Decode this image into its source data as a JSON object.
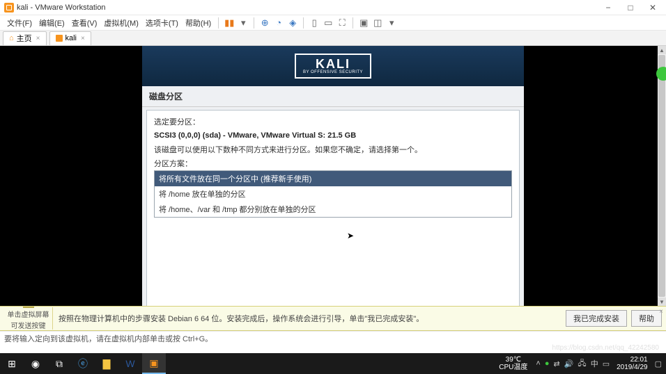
{
  "window": {
    "title": "kali - VMware Workstation"
  },
  "menubar": {
    "items": [
      "文件(F)",
      "编辑(E)",
      "查看(V)",
      "虚拟机(M)",
      "选项卡(T)",
      "帮助(H)"
    ]
  },
  "tabs": {
    "home": "主页",
    "vm": "kali"
  },
  "installer": {
    "logo_main": "KALI",
    "logo_sub": "BY OFFENSIVE SECURITY",
    "section_title": "磁盘分区",
    "prompt": "选定要分区：",
    "disk": "SCSI3 (0,0,0) (sda) - VMware, VMware Virtual S: 21.5 GB",
    "desc": "该磁盘可以使用以下数种不同方式来进行分区。如果您不确定，请选择第一个。",
    "scheme_label": "分区方案：",
    "options": [
      "将所有文件放在同一个分区中 (推荐新手使用)",
      "将 /home 放在单独的分区",
      "将 /home、/var 和 /tmp 都分别放在单独的分区"
    ],
    "selected": 0
  },
  "help_bar": {
    "icon_text1": "单击虚拟屏幕",
    "icon_text2": "可发送按键",
    "message": "按照在物理计算机中的步骤安装 Debian 6 64 位。安装完成后，操作系统会进行引导，单击\"我已完成安装\"。",
    "done_btn": "我已完成安装",
    "help_btn": "帮助"
  },
  "statusline": {
    "text": "要将输入定向到该虚拟机，请在虚拟机内部单击或按 Ctrl+G。"
  },
  "taskbar": {
    "temp_val": "39℃",
    "temp_label": "CPU温度",
    "clock_time": "22:01",
    "clock_date": "2019/4/29"
  },
  "watermark": "https://blog.csdn.net/qq_42242580"
}
